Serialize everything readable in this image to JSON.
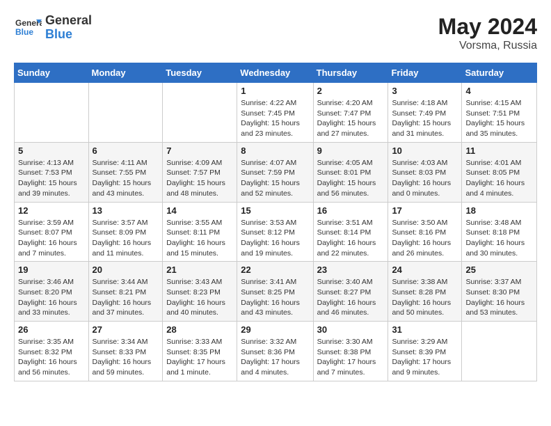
{
  "logo": {
    "line1": "General",
    "line2": "Blue"
  },
  "title": "May 2024",
  "location": "Vorsma, Russia",
  "weekdays": [
    "Sunday",
    "Monday",
    "Tuesday",
    "Wednesday",
    "Thursday",
    "Friday",
    "Saturday"
  ],
  "weeks": [
    [
      {
        "day": "",
        "text": ""
      },
      {
        "day": "",
        "text": ""
      },
      {
        "day": "",
        "text": ""
      },
      {
        "day": "1",
        "text": "Sunrise: 4:22 AM\nSunset: 7:45 PM\nDaylight: 15 hours\nand 23 minutes."
      },
      {
        "day": "2",
        "text": "Sunrise: 4:20 AM\nSunset: 7:47 PM\nDaylight: 15 hours\nand 27 minutes."
      },
      {
        "day": "3",
        "text": "Sunrise: 4:18 AM\nSunset: 7:49 PM\nDaylight: 15 hours\nand 31 minutes."
      },
      {
        "day": "4",
        "text": "Sunrise: 4:15 AM\nSunset: 7:51 PM\nDaylight: 15 hours\nand 35 minutes."
      }
    ],
    [
      {
        "day": "5",
        "text": "Sunrise: 4:13 AM\nSunset: 7:53 PM\nDaylight: 15 hours\nand 39 minutes."
      },
      {
        "day": "6",
        "text": "Sunrise: 4:11 AM\nSunset: 7:55 PM\nDaylight: 15 hours\nand 43 minutes."
      },
      {
        "day": "7",
        "text": "Sunrise: 4:09 AM\nSunset: 7:57 PM\nDaylight: 15 hours\nand 48 minutes."
      },
      {
        "day": "8",
        "text": "Sunrise: 4:07 AM\nSunset: 7:59 PM\nDaylight: 15 hours\nand 52 minutes."
      },
      {
        "day": "9",
        "text": "Sunrise: 4:05 AM\nSunset: 8:01 PM\nDaylight: 15 hours\nand 56 minutes."
      },
      {
        "day": "10",
        "text": "Sunrise: 4:03 AM\nSunset: 8:03 PM\nDaylight: 16 hours\nand 0 minutes."
      },
      {
        "day": "11",
        "text": "Sunrise: 4:01 AM\nSunset: 8:05 PM\nDaylight: 16 hours\nand 4 minutes."
      }
    ],
    [
      {
        "day": "12",
        "text": "Sunrise: 3:59 AM\nSunset: 8:07 PM\nDaylight: 16 hours\nand 7 minutes."
      },
      {
        "day": "13",
        "text": "Sunrise: 3:57 AM\nSunset: 8:09 PM\nDaylight: 16 hours\nand 11 minutes."
      },
      {
        "day": "14",
        "text": "Sunrise: 3:55 AM\nSunset: 8:11 PM\nDaylight: 16 hours\nand 15 minutes."
      },
      {
        "day": "15",
        "text": "Sunrise: 3:53 AM\nSunset: 8:12 PM\nDaylight: 16 hours\nand 19 minutes."
      },
      {
        "day": "16",
        "text": "Sunrise: 3:51 AM\nSunset: 8:14 PM\nDaylight: 16 hours\nand 22 minutes."
      },
      {
        "day": "17",
        "text": "Sunrise: 3:50 AM\nSunset: 8:16 PM\nDaylight: 16 hours\nand 26 minutes."
      },
      {
        "day": "18",
        "text": "Sunrise: 3:48 AM\nSunset: 8:18 PM\nDaylight: 16 hours\nand 30 minutes."
      }
    ],
    [
      {
        "day": "19",
        "text": "Sunrise: 3:46 AM\nSunset: 8:20 PM\nDaylight: 16 hours\nand 33 minutes."
      },
      {
        "day": "20",
        "text": "Sunrise: 3:44 AM\nSunset: 8:21 PM\nDaylight: 16 hours\nand 37 minutes."
      },
      {
        "day": "21",
        "text": "Sunrise: 3:43 AM\nSunset: 8:23 PM\nDaylight: 16 hours\nand 40 minutes."
      },
      {
        "day": "22",
        "text": "Sunrise: 3:41 AM\nSunset: 8:25 PM\nDaylight: 16 hours\nand 43 minutes."
      },
      {
        "day": "23",
        "text": "Sunrise: 3:40 AM\nSunset: 8:27 PM\nDaylight: 16 hours\nand 46 minutes."
      },
      {
        "day": "24",
        "text": "Sunrise: 3:38 AM\nSunset: 8:28 PM\nDaylight: 16 hours\nand 50 minutes."
      },
      {
        "day": "25",
        "text": "Sunrise: 3:37 AM\nSunset: 8:30 PM\nDaylight: 16 hours\nand 53 minutes."
      }
    ],
    [
      {
        "day": "26",
        "text": "Sunrise: 3:35 AM\nSunset: 8:32 PM\nDaylight: 16 hours\nand 56 minutes."
      },
      {
        "day": "27",
        "text": "Sunrise: 3:34 AM\nSunset: 8:33 PM\nDaylight: 16 hours\nand 59 minutes."
      },
      {
        "day": "28",
        "text": "Sunrise: 3:33 AM\nSunset: 8:35 PM\nDaylight: 17 hours\nand 1 minute."
      },
      {
        "day": "29",
        "text": "Sunrise: 3:32 AM\nSunset: 8:36 PM\nDaylight: 17 hours\nand 4 minutes."
      },
      {
        "day": "30",
        "text": "Sunrise: 3:30 AM\nSunset: 8:38 PM\nDaylight: 17 hours\nand 7 minutes."
      },
      {
        "day": "31",
        "text": "Sunrise: 3:29 AM\nSunset: 8:39 PM\nDaylight: 17 hours\nand 9 minutes."
      },
      {
        "day": "",
        "text": ""
      }
    ]
  ]
}
